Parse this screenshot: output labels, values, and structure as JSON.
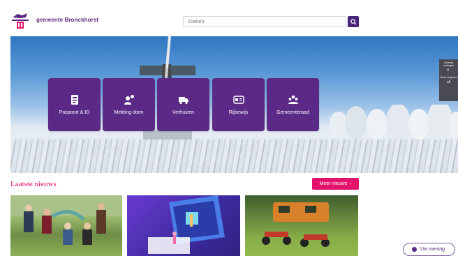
{
  "header": {
    "brand": "gemeente Bronckhorst",
    "search_placeholder": "Zoeken"
  },
  "tiles": [
    {
      "label": "Paspoort & ID",
      "icon": "passport-icon"
    },
    {
      "label": "Melding doen",
      "icon": "report-person-icon"
    },
    {
      "label": "Verhuizen",
      "icon": "moving-truck-icon"
    },
    {
      "label": "Rijbewijs",
      "icon": "drivers-license-icon"
    },
    {
      "label": "Gemeenteraad",
      "icon": "council-icon"
    }
  ],
  "side_panel": {
    "contrast_label": "Contrast verhogen",
    "text_size_label": "Tekst vergroten"
  },
  "news": {
    "title": "Laatste nieuws",
    "more_label": "Meer nieuws",
    "more_icon": "chevron-right-icon"
  },
  "feedback": {
    "label": "Uw mening"
  },
  "colors": {
    "brand_purple": "#5a2a86",
    "accent_pink": "#e3126b"
  }
}
